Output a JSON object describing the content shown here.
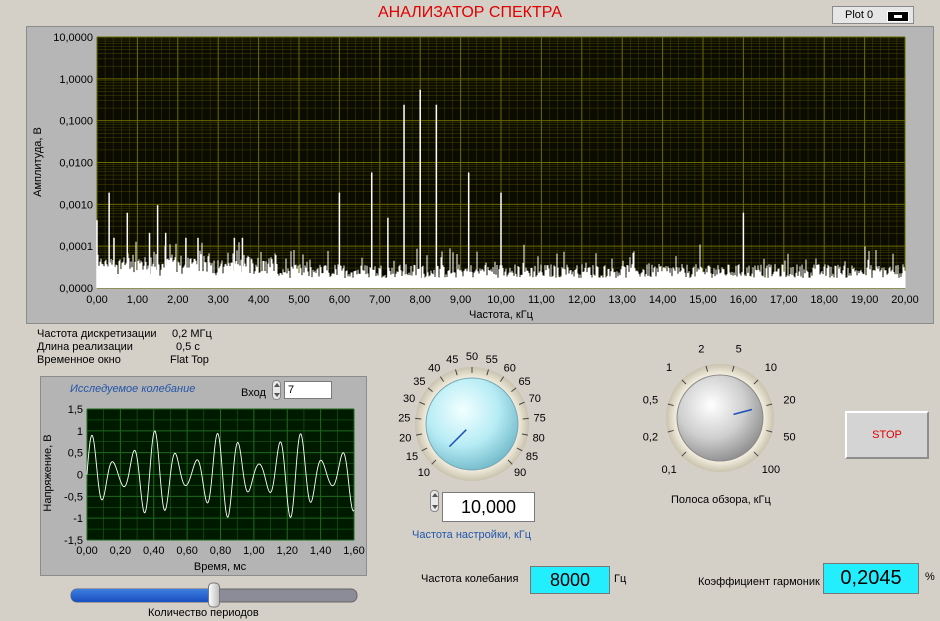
{
  "window": {
    "title": "АНАЛИЗАТОР СПЕКТРА",
    "legend_label": "Plot 0"
  },
  "spectrum": {
    "ylabel": "Амплитуда, В",
    "xlabel": "Частота, кГц",
    "y_ticks": [
      "10,0000",
      "1,0000",
      "0,1000",
      "0,0100",
      "0,0010",
      "0,0001",
      "0,0000"
    ],
    "x_ticks": [
      "0,00",
      "1,00",
      "2,00",
      "3,00",
      "4,00",
      "5,00",
      "6,00",
      "7,00",
      "8,00",
      "9,00",
      "10,00",
      "11,00",
      "12,00",
      "13,00",
      "14,00",
      "15,00",
      "16,00",
      "17,00",
      "18,00",
      "19,00",
      "20,00"
    ],
    "colors": {
      "plot_bg": "#0b0b00",
      "grid": "#6b6b00",
      "trace": "#ffffff"
    }
  },
  "info": {
    "sample_rate_label": "Частота дискретизации",
    "sample_rate_value": "0,2 МГц",
    "length_label": "Длина  реализации",
    "length_value": "0,5 с",
    "window_label": "Временное окно",
    "window_value": "Flat Top"
  },
  "waveform": {
    "title": "Исследуемое колебание",
    "input_label": "Вход",
    "input_value": "7",
    "ylabel": "Напряжение, В",
    "xlabel": "Время, мс",
    "y_ticks": [
      "1,5",
      "1",
      "0,5",
      "0",
      "-0,5",
      "-1",
      "-1,5"
    ],
    "x_ticks": [
      "0,00",
      "0,20",
      "0,40",
      "0,60",
      "0,80",
      "1,00",
      "1,20",
      "1,40",
      "1,60"
    ],
    "colors": {
      "plot_bg": "#001a00",
      "grid": "#1e6a1e",
      "trace": "#ffffff"
    }
  },
  "periods_slider": {
    "label": "Количество периодов",
    "level_fraction": 0.5
  },
  "tuning_knob": {
    "scale": [
      "10",
      "15",
      "20",
      "25",
      "30",
      "35",
      "40",
      "45",
      "50",
      "55",
      "60",
      "65",
      "70",
      "75",
      "80",
      "85",
      "90"
    ],
    "value": "10,000",
    "label": "Частота  настройки,  кГц"
  },
  "span_knob": {
    "scale": [
      "0,1",
      "0,2",
      "0,5",
      "1",
      "2",
      "5",
      "10",
      "20",
      "50",
      "100"
    ],
    "label": "Полоса обзора, кГц"
  },
  "readouts": {
    "freq_label": "Частота  колебания",
    "freq_value": "8000",
    "freq_unit": "Гц",
    "thd_label": "Коэффициент гармоник",
    "thd_value": "0,2045",
    "thd_unit": "%"
  },
  "stop_label": "STOP"
}
